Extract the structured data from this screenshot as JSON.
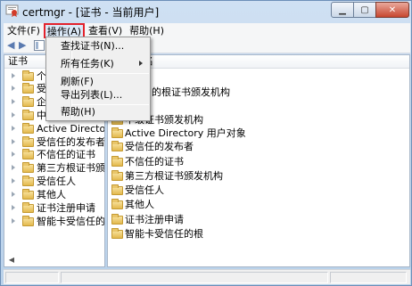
{
  "window": {
    "title": "certmgr - [证书 - 当前用户]",
    "controls": {
      "minimize": "▁",
      "maximize": "▢",
      "close": "✕"
    }
  },
  "menubar": {
    "items": [
      {
        "label": "文件(F)"
      },
      {
        "label": "操作(A)"
      },
      {
        "label": "查看(V)"
      },
      {
        "label": "帮助(H)"
      }
    ]
  },
  "dropdown": {
    "items": [
      {
        "label": "查找证书(N)..."
      },
      {
        "label": "所有任务(K)"
      },
      {
        "label": "刷新(F)"
      },
      {
        "label": "导出列表(L)..."
      },
      {
        "label": "帮助(H)"
      }
    ]
  },
  "left_pane": {
    "header": "证书",
    "tree": [
      {
        "label": "个人"
      },
      {
        "label": "受信任"
      },
      {
        "label": "企业"
      },
      {
        "label": "中级"
      },
      {
        "label": "Active Directory 用"
      },
      {
        "label": "受信任的发布者"
      },
      {
        "label": "不信任的证书"
      },
      {
        "label": "第三方根证书颁发"
      },
      {
        "label": "受信任人"
      },
      {
        "label": "其他人"
      },
      {
        "label": "证书注册申请"
      },
      {
        "label": "智能卡受信任的根"
      }
    ]
  },
  "right_pane": {
    "header": "名",
    "items": [
      {
        "label": "的根证书颁发机构"
      },
      {
        "label": "任"
      },
      {
        "label": "中级证书颁发机构"
      },
      {
        "label": "Active Directory 用户对象"
      },
      {
        "label": "受信任的发布者"
      },
      {
        "label": "不信任的证书"
      },
      {
        "label": "第三方根证书颁发机构"
      },
      {
        "label": "受信任人"
      },
      {
        "label": "其他人"
      },
      {
        "label": "证书注册申请"
      },
      {
        "label": "智能卡受信任的根"
      }
    ]
  }
}
